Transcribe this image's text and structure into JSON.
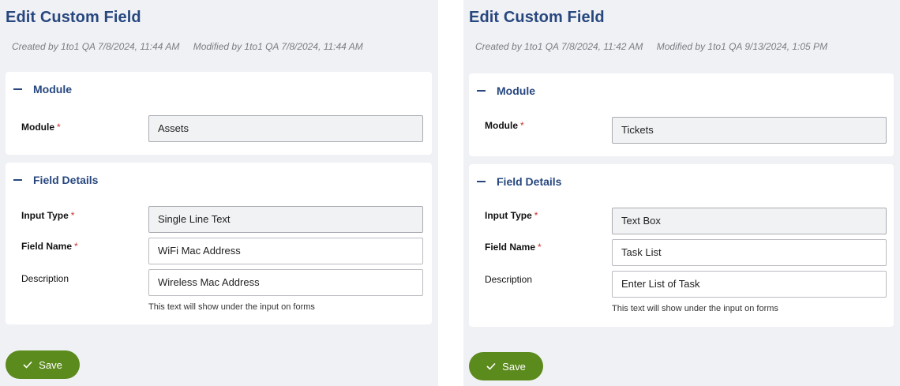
{
  "left": {
    "title": "Edit Custom Field",
    "created": "Created by 1to1 QA 7/8/2024, 11:44 AM",
    "modified": "Modified by 1to1 QA 7/8/2024, 11:44 AM",
    "module_section": "Module",
    "module_label": "Module",
    "module_value": "Assets",
    "details_section": "Field Details",
    "input_type_label": "Input Type",
    "input_type_value": "Single Line Text",
    "field_name_label": "Field Name",
    "field_name_value": "WiFi Mac Address",
    "description_label": "Description",
    "description_value": "Wireless Mac Address",
    "hint": "This text will show under the input on forms",
    "save_label": "Save"
  },
  "right": {
    "title": "Edit Custom Field",
    "created": "Created by 1to1 QA 7/8/2024, 11:42 AM",
    "modified": "Modified by 1to1 QA 9/13/2024, 1:05 PM",
    "module_section": "Module",
    "module_label": "Module",
    "module_value": "Tickets",
    "details_section": "Field Details",
    "input_type_label": "Input Type",
    "input_type_value": "Text Box",
    "field_name_label": "Field Name",
    "field_name_value": "Task List",
    "description_label": "Description",
    "description_value": "Enter List of Task",
    "hint": "This text will show under the input on forms",
    "save_label": "Save"
  },
  "required_marker": "*",
  "colors": {
    "title": "#27477f",
    "save_button": "#5b8a1d",
    "required": "#c8322b",
    "background": "#f0f1f4"
  }
}
